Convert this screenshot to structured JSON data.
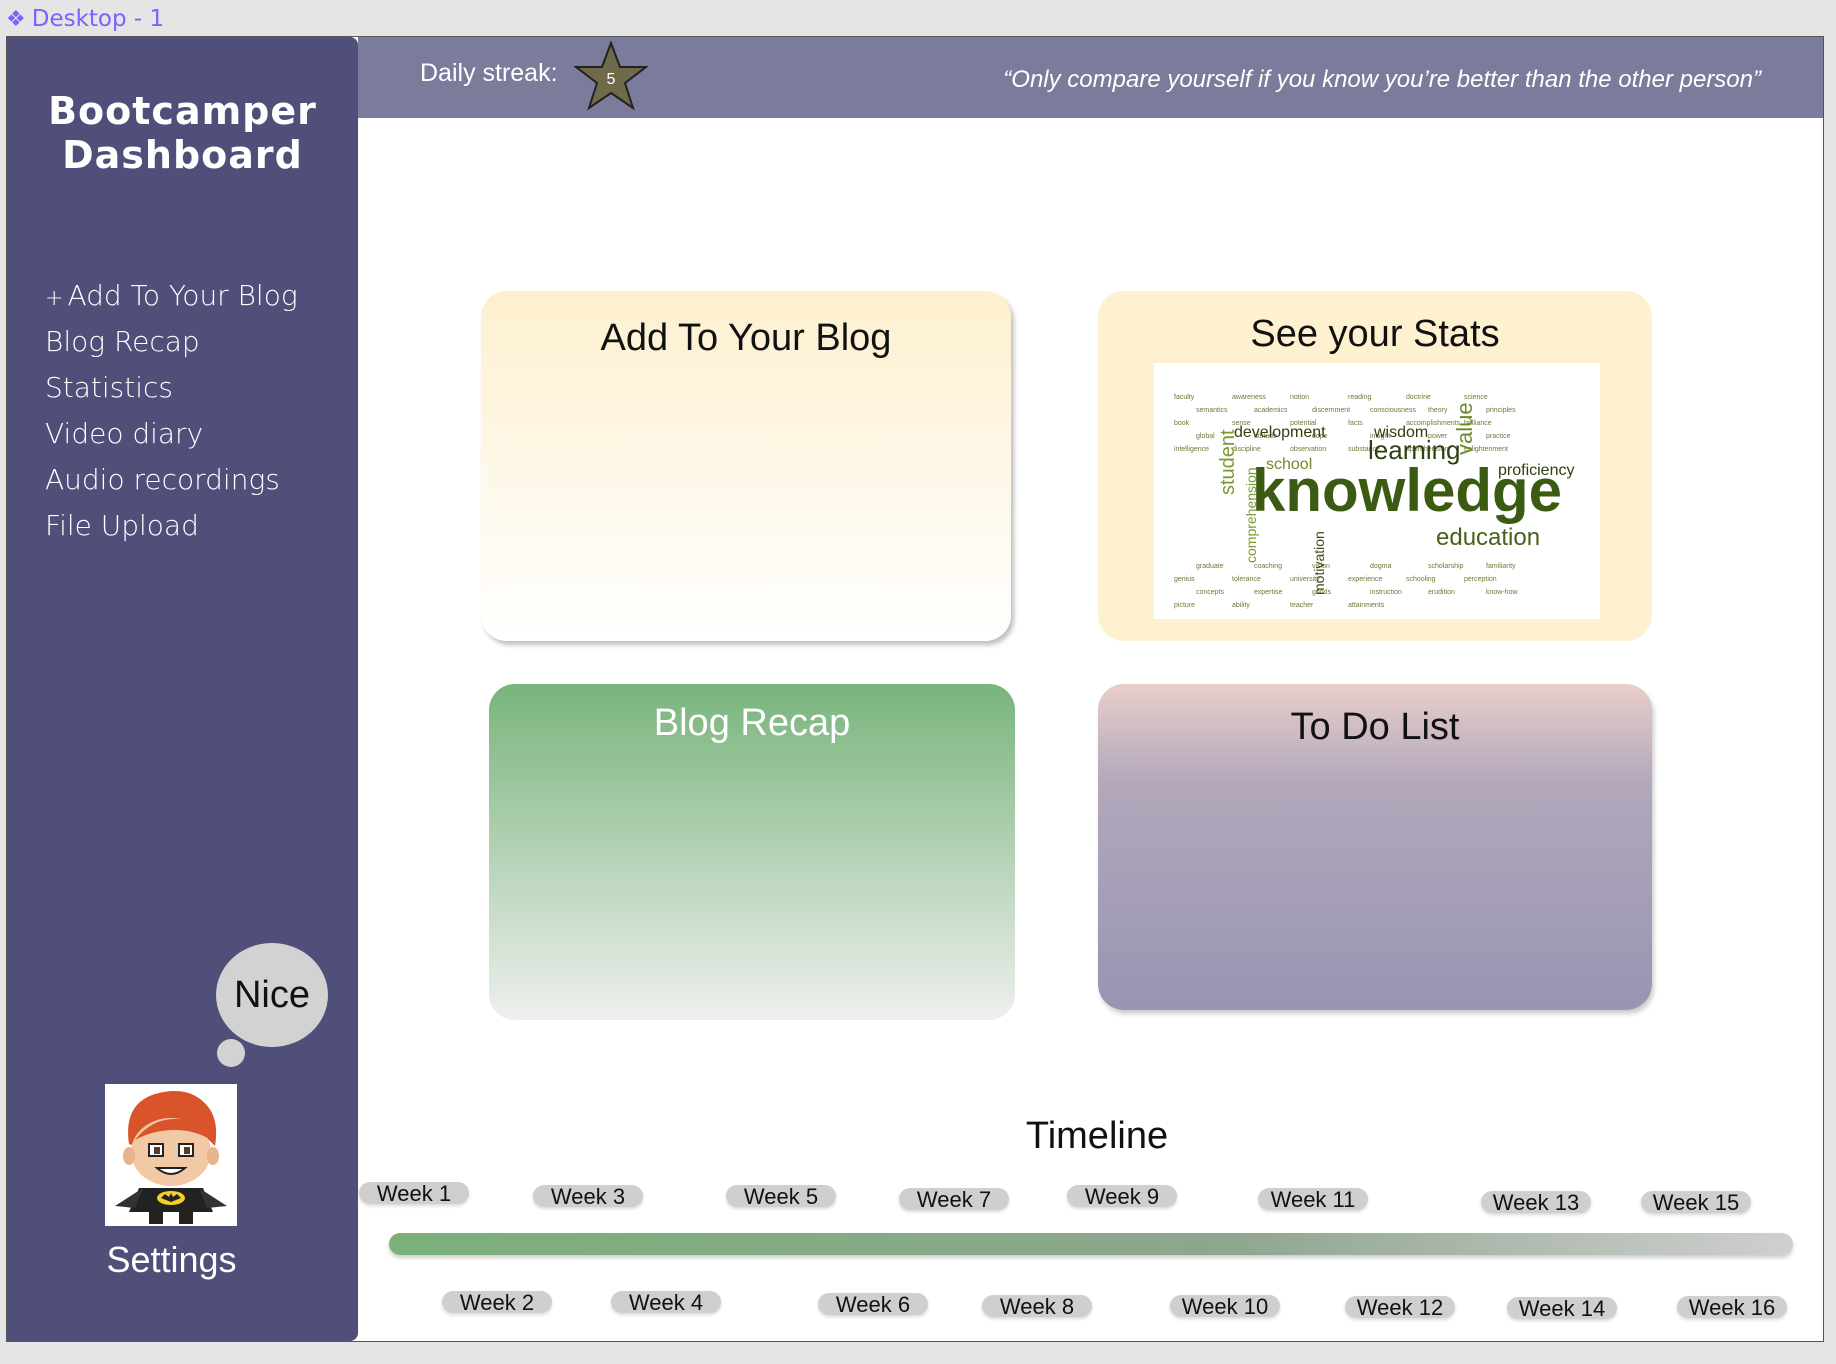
{
  "frame": {
    "label": "Desktop - 1",
    "icon": "component-icon",
    "label_color": "#7b61ff"
  },
  "sidebar": {
    "title": "Bootcamper Dashboard",
    "background": "#4f4f7a",
    "items": [
      {
        "prefix": "+",
        "label": "Add To Your Blog"
      },
      {
        "label": "Blog Recap"
      },
      {
        "label": "Statistics"
      },
      {
        "label": "Video diary"
      },
      {
        "label": "Audio recordings"
      },
      {
        "label": "File Upload"
      }
    ],
    "bubble_text": "Nice",
    "avatar_icon": "cartoon-avatar-icon",
    "settings_label": "Settings"
  },
  "header": {
    "background": "#7b7b9b",
    "streak_label": "Daily streak:",
    "streak_value": "5",
    "quote": "“Only compare yourself if you know you’re better than the other person”"
  },
  "cards": {
    "add_blog": {
      "title": "Add To Your Blog"
    },
    "stats": {
      "title": "See your Stats",
      "image_icon": "word-cloud-image"
    },
    "blog_recap": {
      "title": "Blog Recap"
    },
    "todo": {
      "title": "To Do List"
    }
  },
  "wordcloud": {
    "knowledge": "knowledge",
    "education": "education",
    "learning": "learning",
    "development": "development",
    "wisdom": "wisdom",
    "proficiency": "proficiency",
    "school": "school",
    "student": "student",
    "value": "value",
    "comprehension": "comprehension",
    "motivation": "motivation",
    "small": [
      "faculty",
      "awareness",
      "notion",
      "reading",
      "doctrine",
      "science",
      "semantics",
      "academics",
      "discernment",
      "consciousness",
      "theory",
      "principles",
      "book",
      "sense",
      "potential",
      "facts",
      "accomplishments",
      "brilliance",
      "global",
      "attitude",
      "dope",
      "insight",
      "power",
      "practice",
      "intelligence",
      "discipline",
      "observation",
      "substance",
      "apprehension",
      "enlightenment",
      "graduate",
      "coaching",
      "vision",
      "dogma",
      "scholarship",
      "familiarity",
      "genius",
      "tolerance",
      "university",
      "experience",
      "schooling",
      "perception",
      "concepts",
      "expertise",
      "goods",
      "instruction",
      "erudition",
      "know-how",
      "picture",
      "ability",
      "teacher",
      "attainments"
    ]
  },
  "timeline": {
    "title": "Timeline",
    "top_weeks": [
      "Week 1",
      "Week 3",
      "Week 5",
      "Week 7",
      "Week 9",
      "Week 11",
      "Week 13",
      "Week 15"
    ],
    "bottom_weeks": [
      "Week 2",
      "Week 4",
      "Week 6",
      "Week 8",
      "Week 10",
      "Week 12",
      "Week 14",
      "Week 16"
    ]
  }
}
